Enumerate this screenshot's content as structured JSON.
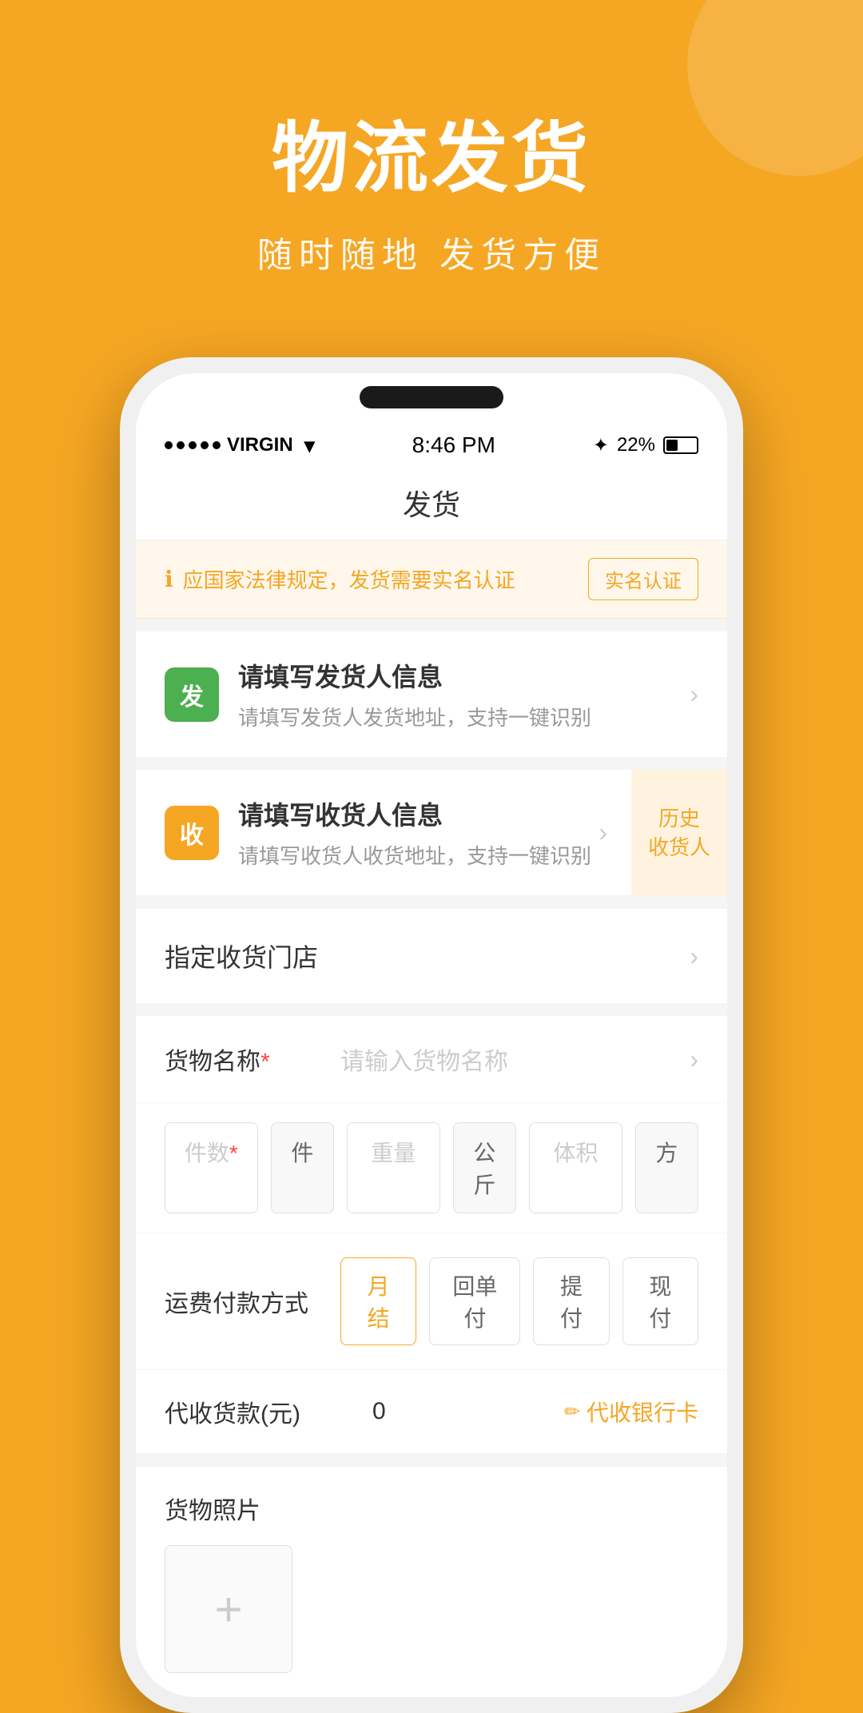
{
  "background_color": "#F5A623",
  "hero": {
    "title": "物流发货",
    "subtitle": "随时随地  发货方便"
  },
  "status_bar": {
    "carrier": "VIRGIN",
    "time": "8:46 PM",
    "battery_percent": "22%"
  },
  "nav": {
    "title": "发货"
  },
  "notice": {
    "icon": "ℹ",
    "text": "应国家法律规定，发货需要实名认证",
    "button": "实名认证"
  },
  "sender_section": {
    "icon_label": "发",
    "title": "请填写发货人信息",
    "subtitle": "请填写发货人发货地址，支持一键识别"
  },
  "receiver_section": {
    "icon_label": "收",
    "title": "请填写收货人信息",
    "subtitle": "请填写收货人收货地址，支持一键识别",
    "history_label": "历史\n收货人"
  },
  "store_row": {
    "label": "指定收货门店"
  },
  "form": {
    "goods_name_label": "货物名称",
    "goods_name_required": "*",
    "goods_name_placeholder": "请输入货物名称",
    "quantity_placeholder": "件数",
    "quantity_required": "*",
    "quantity_unit": "件",
    "weight_placeholder": "重量",
    "weight_unit": "公斤",
    "volume_placeholder": "体积",
    "volume_unit": "方"
  },
  "payment": {
    "label": "运费付款方式",
    "options": [
      "月结",
      "回单付",
      "提付",
      "现付"
    ],
    "active_index": 0
  },
  "cod": {
    "label": "代收货款(元)",
    "value": "0",
    "link_label": "代收银行卡",
    "link_icon": "✏"
  },
  "photo": {
    "label": "货物照片",
    "add_icon": "+"
  }
}
